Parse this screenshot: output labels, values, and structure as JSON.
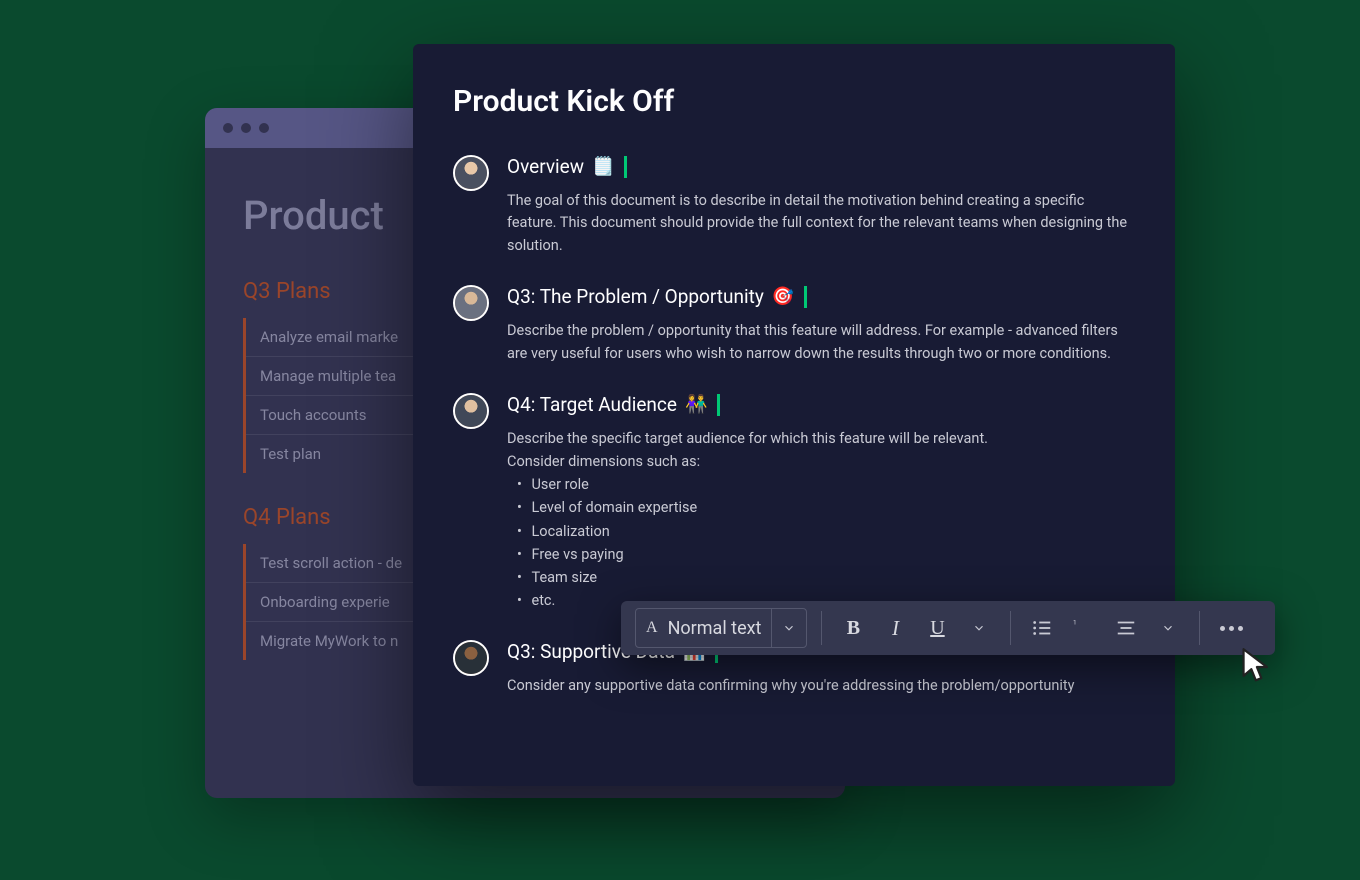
{
  "backWindow": {
    "title": "Product",
    "groups": [
      {
        "heading": "Q3 Plans",
        "items": [
          "Analyze email marke",
          "Manage multiple tea",
          "Touch accounts",
          "Test plan"
        ]
      },
      {
        "heading": "Q4 Plans",
        "items": [
          "Test scroll action - de",
          "Onboarding experie",
          "Migrate MyWork to n"
        ]
      }
    ]
  },
  "frontWindow": {
    "title": "Product Kick Off",
    "sections": [
      {
        "heading": "Overview",
        "emoji": "🗒️",
        "text": "The goal of this document is to describe in detail the motivation behind creating a specific feature. This document should provide the full context for the relevant teams when designing the solution."
      },
      {
        "heading": "Q3: The Problem / Opportunity",
        "emoji": "🎯",
        "text": "Describe the problem / opportunity that this feature will address. For example - advanced filters are very useful for users who wish to narrow down the results through two or more conditions."
      },
      {
        "heading": "Q4: Target Audience",
        "emoji": "👫",
        "text": "Describe the specific target audience for which this feature will be relevant.",
        "text2": "Consider dimensions such as:",
        "list": [
          "User role",
          "Level of domain expertise",
          "Localization",
          "Free vs paying",
          "Team size",
          "etc."
        ]
      },
      {
        "heading": "Q3: Supportive Data",
        "emoji": "📊",
        "text": "Consider any supportive data confirming why you're addressing the problem/opportunity"
      }
    ]
  },
  "toolbar": {
    "styleLabel": "Normal text"
  }
}
